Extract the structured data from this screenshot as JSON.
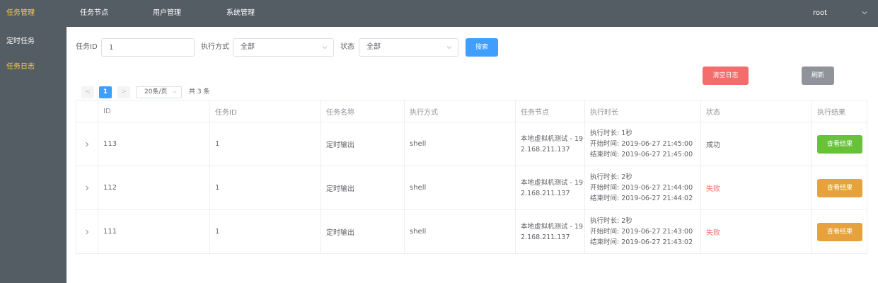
{
  "topnav": {
    "items": [
      "任务管理",
      "任务节点",
      "用户管理",
      "系统管理"
    ],
    "active_index": 0,
    "user": "root"
  },
  "sidebar": {
    "items": [
      "定时任务",
      "任务日志"
    ],
    "active_index": 1
  },
  "filter": {
    "task_id_label": "任务ID",
    "task_id_value": "1",
    "exec_mode_label": "执行方式",
    "exec_mode_value": "全部",
    "status_label": "状态",
    "status_value": "全部",
    "search_label": "搜索"
  },
  "actions": {
    "clear_log_label": "清空日志",
    "refresh_label": "刷新"
  },
  "pagination": {
    "prev": "<",
    "current_page": "1",
    "next": ">",
    "page_size": "20条/页",
    "total": "共 3 条"
  },
  "table": {
    "columns": [
      "ID",
      "任务ID",
      "任务名称",
      "执行方式",
      "任务节点",
      "执行时长",
      "状态",
      "执行结果"
    ],
    "rows": [
      {
        "id": "113",
        "task_id": "1",
        "name": "定时输出",
        "mode": "shell",
        "node_line1": "本地虚拟机测试 - 19",
        "node_line2": "2.168.211.137",
        "duration": "执行时长: 1秒",
        "start": "开始时间: 2019-06-27 21:45:00",
        "end": "结束时间: 2019-06-27 21:45:00",
        "status": "成功",
        "result_label": "查看结果"
      },
      {
        "id": "112",
        "task_id": "1",
        "name": "定时输出",
        "mode": "shell",
        "node_line1": "本地虚拟机测试 - 19",
        "node_line2": "2.168.211.137",
        "duration": "执行时长: 2秒",
        "start": "开始时间: 2019-06-27 21:44:00",
        "end": "结束时间: 2019-06-27 21:44:02",
        "status": "失败",
        "result_label": "查看结果"
      },
      {
        "id": "111",
        "task_id": "1",
        "name": "定时输出",
        "mode": "shell",
        "node_line1": "本地虚拟机测试 - 19",
        "node_line2": "2.168.211.137",
        "duration": "执行时长: 2秒",
        "start": "开始时间: 2019-06-27 21:43:00",
        "end": "结束时间: 2019-06-27 21:43:02",
        "status": "失败",
        "result_label": "查看结果"
      }
    ]
  },
  "colors": {
    "nav_bg": "#545c64",
    "nav_active": "#ffd04b",
    "primary": "#409eff",
    "danger": "#f56c6c",
    "success": "#67c23a",
    "warning": "#e6a23c",
    "info": "#909399"
  },
  "icons": {
    "user_menu": "chevron-down-icon",
    "select": "chevron-down-icon",
    "row_expand": "chevron-right-icon"
  }
}
